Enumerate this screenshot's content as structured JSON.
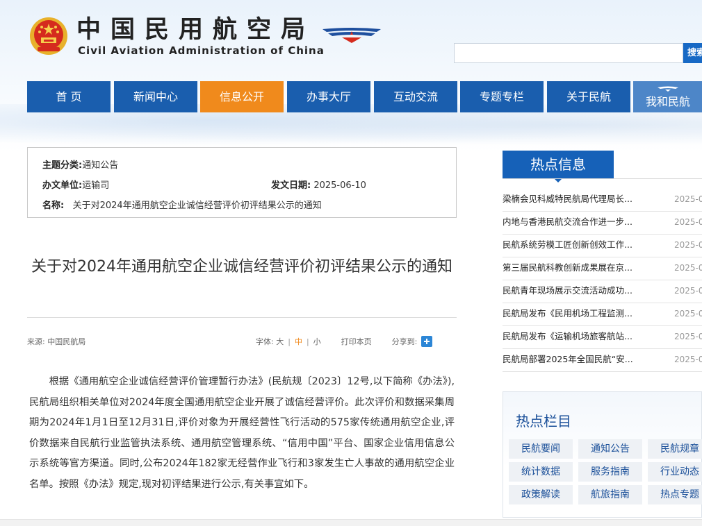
{
  "header": {
    "title_cn": "中国民用航空局",
    "title_en": "Civil Aviation Administration of China",
    "search_button": "搜索",
    "search_placeholder": ""
  },
  "nav": [
    {
      "label": "首 页"
    },
    {
      "label": "新闻中心"
    },
    {
      "label": "信息公开",
      "active": true
    },
    {
      "label": "办事大厅"
    },
    {
      "label": "互动交流"
    },
    {
      "label": "专题专栏"
    },
    {
      "label": "关于民航"
    },
    {
      "label": "我和民航"
    }
  ],
  "meta": {
    "category_label": "主题分类:",
    "category_value": "通知公告",
    "unit_label": "办文单位:",
    "unit_value": "运输司",
    "date_label": "发文日期:",
    "date_value": "2025-06-10",
    "name_label": "名称:",
    "name_value": "关于对2024年通用航空企业诚信经营评价初评结果公示的通知"
  },
  "article": {
    "title": "关于对2024年通用航空企业诚信经营评价初评结果公示的通知",
    "source": "来源: 中国民航局",
    "font_label": "字体:",
    "font_large": "大",
    "font_medium": "中",
    "font_small": "小",
    "print": "打印本页",
    "share": "分享到:",
    "body": "根据《通用航空企业诚信经营评价管理暂行办法》(民航规〔2023〕12号,以下简称《办法》),民航局组织相关单位对2024年度全国通用航空企业开展了诚信经营评价。此次评价和数据采集周期为2024年1月1日至12月31日,评价对象为开展经营性飞行活动的575家传统通用航空企业,评价数据来自民航行业监管执法系统、通用航空管理系统、“信用中国”平台、国家企业信用信息公示系统等官方渠道。同时,公布2024年182家无经营作业飞行和3家发生亡人事故的通用航空企业名单。按照《办法》规定,现对初评结果进行公示,有关事宜如下。"
  },
  "hot_info": {
    "title": "热点信息",
    "items": [
      {
        "title": "梁楠会见科威特民航局代理局长...",
        "date": "2025-0"
      },
      {
        "title": "内地与香港民航交流合作进一步...",
        "date": "2025-0"
      },
      {
        "title": "民航系统劳模工匠创新创效工作...",
        "date": "2025-0"
      },
      {
        "title": "第三届民航科教创新成果展在京...",
        "date": "2025-0"
      },
      {
        "title": "民航青年现场展示交流活动成功...",
        "date": "2025-0"
      },
      {
        "title": "民航局发布《民用机场工程监测...",
        "date": "2025-0"
      },
      {
        "title": "民航局发布《运输机场旅客航站...",
        "date": "2025-0"
      },
      {
        "title": "民航局部署2025年全国民航“安...",
        "date": "2025-0"
      }
    ]
  },
  "hot_columns": {
    "title": "热点栏目",
    "items": [
      {
        "label": "民航要闻"
      },
      {
        "label": "通知公告"
      },
      {
        "label": "民航规章"
      },
      {
        "label": "统计数据"
      },
      {
        "label": "服务指南"
      },
      {
        "label": "行业动态"
      },
      {
        "label": "政策解读"
      },
      {
        "label": "航旅指南"
      },
      {
        "label": "热点专题"
      }
    ]
  },
  "colors": {
    "nav_blue": "#1a5eae",
    "nav_active": "#f08a1c",
    "hot_tab": "#1661b8"
  }
}
